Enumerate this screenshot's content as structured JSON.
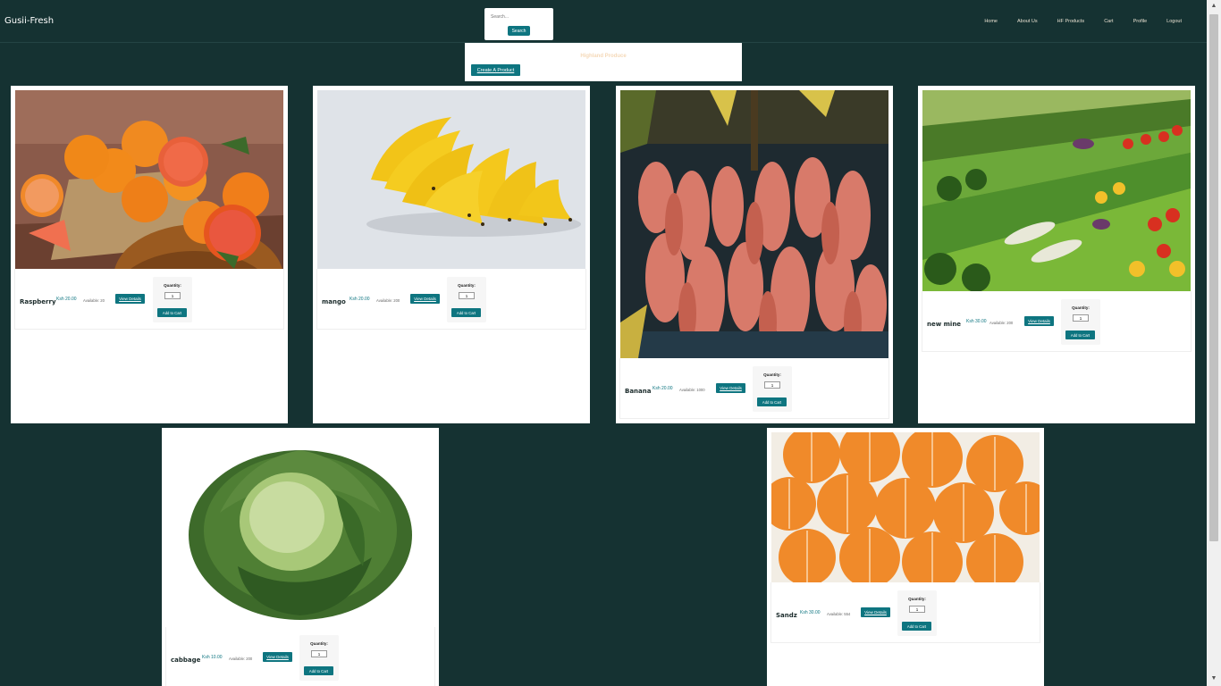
{
  "brand": "Gusii-Fresh",
  "search": {
    "placeholder": "Search...",
    "button": "Search"
  },
  "nav": [
    "Home",
    "About Us",
    "HF Products",
    "Cart",
    "Profile",
    "Logout"
  ],
  "header_panel": {
    "title": "Highland Produce",
    "create_button": "Create A Product"
  },
  "quantity_label": "Quantity:",
  "quantity_default": "1",
  "view_details_label": "View Details",
  "add_to_cart_label": "Add to Cart",
  "products": [
    {
      "name": "Raspberry",
      "price": "Ksh 20.00",
      "available": "Available: 20",
      "image": "oranges"
    },
    {
      "name": "mango",
      "price": "Ksh 20.00",
      "available": "Available: 200",
      "image": "bananas"
    },
    {
      "name": "Banana",
      "price": "Ksh 20.00",
      "available": "Available: 1000",
      "image": "red-bananas"
    },
    {
      "name": "new mine",
      "price": "Ksh 30.00",
      "available": "Available: 200",
      "image": "vegetable-shelves"
    },
    {
      "name": "cabbage",
      "price": "Ksh 10.00",
      "available": "Available: 200",
      "image": "cabbage"
    },
    {
      "name": "Sandz",
      "price": "Ksh 30.00",
      "available": "Available: 554",
      "image": "tangerines"
    }
  ],
  "colors": {
    "background": "#153232",
    "accent": "#0e7580",
    "card": "#ffffff",
    "title": "#f5d9b8"
  }
}
